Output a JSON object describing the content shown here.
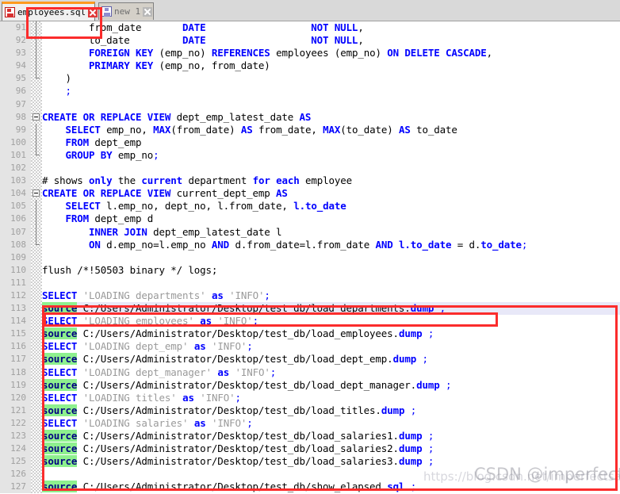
{
  "window": {
    "app": "notepad-plus-plus-sql-editor"
  },
  "tabs": [
    {
      "label": "employees.sql",
      "icon": "floppy-disk-red-icon",
      "close_icon": "close-icon",
      "active": true
    },
    {
      "label": "new 1",
      "icon": "floppy-disk-blue-icon",
      "close_icon": "close-icon",
      "active": false
    }
  ],
  "editor": {
    "first_line_number": 91,
    "highlighted_line_number": 113,
    "lines": [
      {
        "n": 91,
        "text": "        from_date       DATE                  NOT NULL,"
      },
      {
        "n": 92,
        "text": "        to_date         DATE                  NOT NULL,"
      },
      {
        "n": 93,
        "text": "        FOREIGN KEY (emp_no) REFERENCES employees (emp_no) ON DELETE CASCADE,"
      },
      {
        "n": 94,
        "text": "        PRIMARY KEY (emp_no, from_date)"
      },
      {
        "n": 95,
        "text": "    )"
      },
      {
        "n": 96,
        "text": "    ;"
      },
      {
        "n": 97,
        "text": ""
      },
      {
        "n": 98,
        "text": "CREATE OR REPLACE VIEW dept_emp_latest_date AS"
      },
      {
        "n": 99,
        "text": "    SELECT emp_no, MAX(from_date) AS from_date, MAX(to_date) AS to_date"
      },
      {
        "n": 100,
        "text": "    FROM dept_emp"
      },
      {
        "n": 101,
        "text": "    GROUP BY emp_no;"
      },
      {
        "n": 102,
        "text": ""
      },
      {
        "n": 103,
        "text": "# shows only the current department for each employee"
      },
      {
        "n": 104,
        "text": "CREATE OR REPLACE VIEW current_dept_emp AS"
      },
      {
        "n": 105,
        "text": "    SELECT l.emp_no, dept_no, l.from_date, l.to_date"
      },
      {
        "n": 106,
        "text": "    FROM dept_emp d"
      },
      {
        "n": 107,
        "text": "        INNER JOIN dept_emp_latest_date l"
      },
      {
        "n": 108,
        "text": "        ON d.emp_no=l.emp_no AND d.from_date=l.from_date AND l.to_date = d.to_date;"
      },
      {
        "n": 109,
        "text": ""
      },
      {
        "n": 110,
        "text": "flush /*!50503 binary */ logs;"
      },
      {
        "n": 111,
        "text": ""
      },
      {
        "n": 112,
        "text": "SELECT 'LOADING departments' as 'INFO';"
      },
      {
        "n": 113,
        "text": "source C:/Users/Administrator/Desktop/test_db/load_departments.dump ;"
      },
      {
        "n": 114,
        "text": "SELECT 'LOADING employees' as 'INFO';"
      },
      {
        "n": 115,
        "text": "source C:/Users/Administrator/Desktop/test_db/load_employees.dump ;"
      },
      {
        "n": 116,
        "text": "SELECT 'LOADING dept_emp' as 'INFO';"
      },
      {
        "n": 117,
        "text": "source C:/Users/Administrator/Desktop/test_db/load_dept_emp.dump ;"
      },
      {
        "n": 118,
        "text": "SELECT 'LOADING dept_manager' as 'INFO';"
      },
      {
        "n": 119,
        "text": "source C:/Users/Administrator/Desktop/test_db/load_dept_manager.dump ;"
      },
      {
        "n": 120,
        "text": "SELECT 'LOADING titles' as 'INFO';"
      },
      {
        "n": 121,
        "text": "source C:/Users/Administrator/Desktop/test_db/load_titles.dump ;"
      },
      {
        "n": 122,
        "text": "SELECT 'LOADING salaries' as 'INFO';"
      },
      {
        "n": 123,
        "text": "source C:/Users/Administrator/Desktop/test_db/load_salaries1.dump ;"
      },
      {
        "n": 124,
        "text": "source C:/Users/Administrator/Desktop/test_db/load_salaries2.dump ;"
      },
      {
        "n": 125,
        "text": "source C:/Users/Administrator/Desktop/test_db/load_salaries3.dump ;"
      },
      {
        "n": 126,
        "text": ""
      },
      {
        "n": 127,
        "text": "source C:/Users/Administrator/Desktop/test_db/show_elapsed.sql ;"
      }
    ]
  },
  "watermark": {
    "url": "https://blog.csdn.net/imperfectsam",
    "text": "CSDN @imperfectsam"
  },
  "colors": {
    "keyword": "#0000ff",
    "string": "#9a9a9a",
    "comment": "#008000",
    "source_highlight_bg": "#8ef08e",
    "current_line_bg": "#e8e8f8",
    "annotation_red": "#fb2c2c",
    "active_tab_accent": "#ff9a1f"
  }
}
